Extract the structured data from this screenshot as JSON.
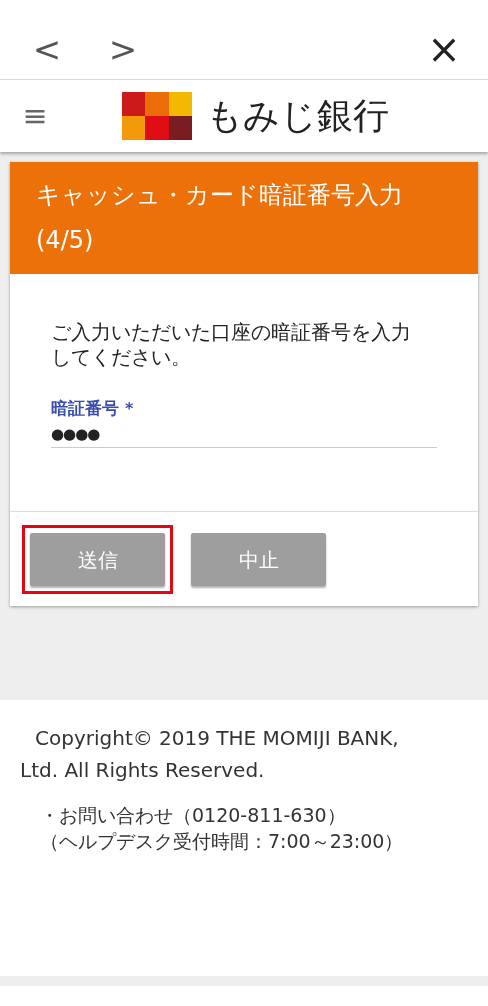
{
  "browser_bar": {
    "back": "<",
    "forward": ">",
    "close": "×"
  },
  "header": {
    "menu": "≡",
    "logo_text": "もみじ銀行"
  },
  "card": {
    "title": "キャッシュ・カード暗証番号入力(4/5)",
    "message": "ご入力いただいた口座の暗証番号を入力してください。",
    "field": {
      "label": "暗証番号",
      "required_mark": "*",
      "value": "●●●●"
    },
    "buttons": [
      {
        "label": "送信",
        "highlighted": true
      },
      {
        "label": "中止",
        "highlighted": false
      }
    ]
  },
  "footer": {
    "copyright": "Copyright© 2019 THE MOMIJI BANK, Ltd. All Rights Reserved.",
    "contact": [
      "・お問い合わせ（0120-811-630）",
      "（ヘルプデスク受付時間：7:00～23:00）"
    ]
  }
}
